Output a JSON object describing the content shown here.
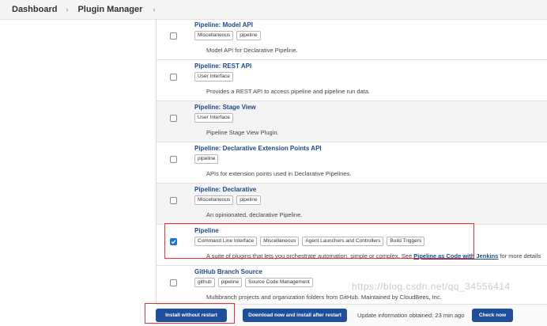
{
  "breadcrumb": {
    "items": [
      "Dashboard",
      "Plugin Manager"
    ],
    "separator": "›"
  },
  "plugins": [
    {
      "name": "Pipeline: Model API",
      "tags": [
        "Miscellaneous",
        "pipeline"
      ],
      "description": "Model API for Declarative Pipeline.",
      "checked": false
    },
    {
      "name": "Pipeline: REST API",
      "tags": [
        "User Interface"
      ],
      "description": "Provides a REST API to access pipeline and pipeline run data.",
      "checked": false
    },
    {
      "name": "Pipeline: Stage View",
      "tags": [
        "User Interface"
      ],
      "description": "Pipeline Stage View Plugin.",
      "checked": false
    },
    {
      "name": "Pipeline: Declarative Extension Points API",
      "tags": [
        "pipeline"
      ],
      "description": "APIs for extension points used in Declarative Pipelines.",
      "checked": false
    },
    {
      "name": "Pipeline: Declarative",
      "tags": [
        "Miscellaneous",
        "pipeline"
      ],
      "description": "An opinionated, declarative Pipeline.",
      "checked": false
    },
    {
      "name": "Pipeline",
      "tags": [
        "Command Line Interface",
        "Miscellaneous",
        "Agent Launchers and Controllers",
        "Build Triggers"
      ],
      "description": "A suite of plugins that lets you orchestrate automation, simple or complex. See ",
      "description_link": "Pipeline as Code with Jenkins",
      "description_suffix": " for more details",
      "checked": true
    },
    {
      "name": "GitHub Branch Source",
      "tags": [
        "github",
        "pipeline",
        "Source Code Management"
      ],
      "description": "Multibranch projects and organization folders from GitHub. Maintained by CloudBees, Inc.",
      "checked": false
    }
  ],
  "footer": {
    "install_label": "Install without restart",
    "download_label": "Download now and install after restart",
    "update_info": "Update information obtained: 23 min ago",
    "check_label": "Check now"
  },
  "watermark": "https://blog.csdn.net/qq_34556414",
  "colors": {
    "link": "#204a87",
    "button": "#1f4e9b",
    "checkbox_checked": "#1a73d9",
    "highlight": "#ee3333"
  }
}
